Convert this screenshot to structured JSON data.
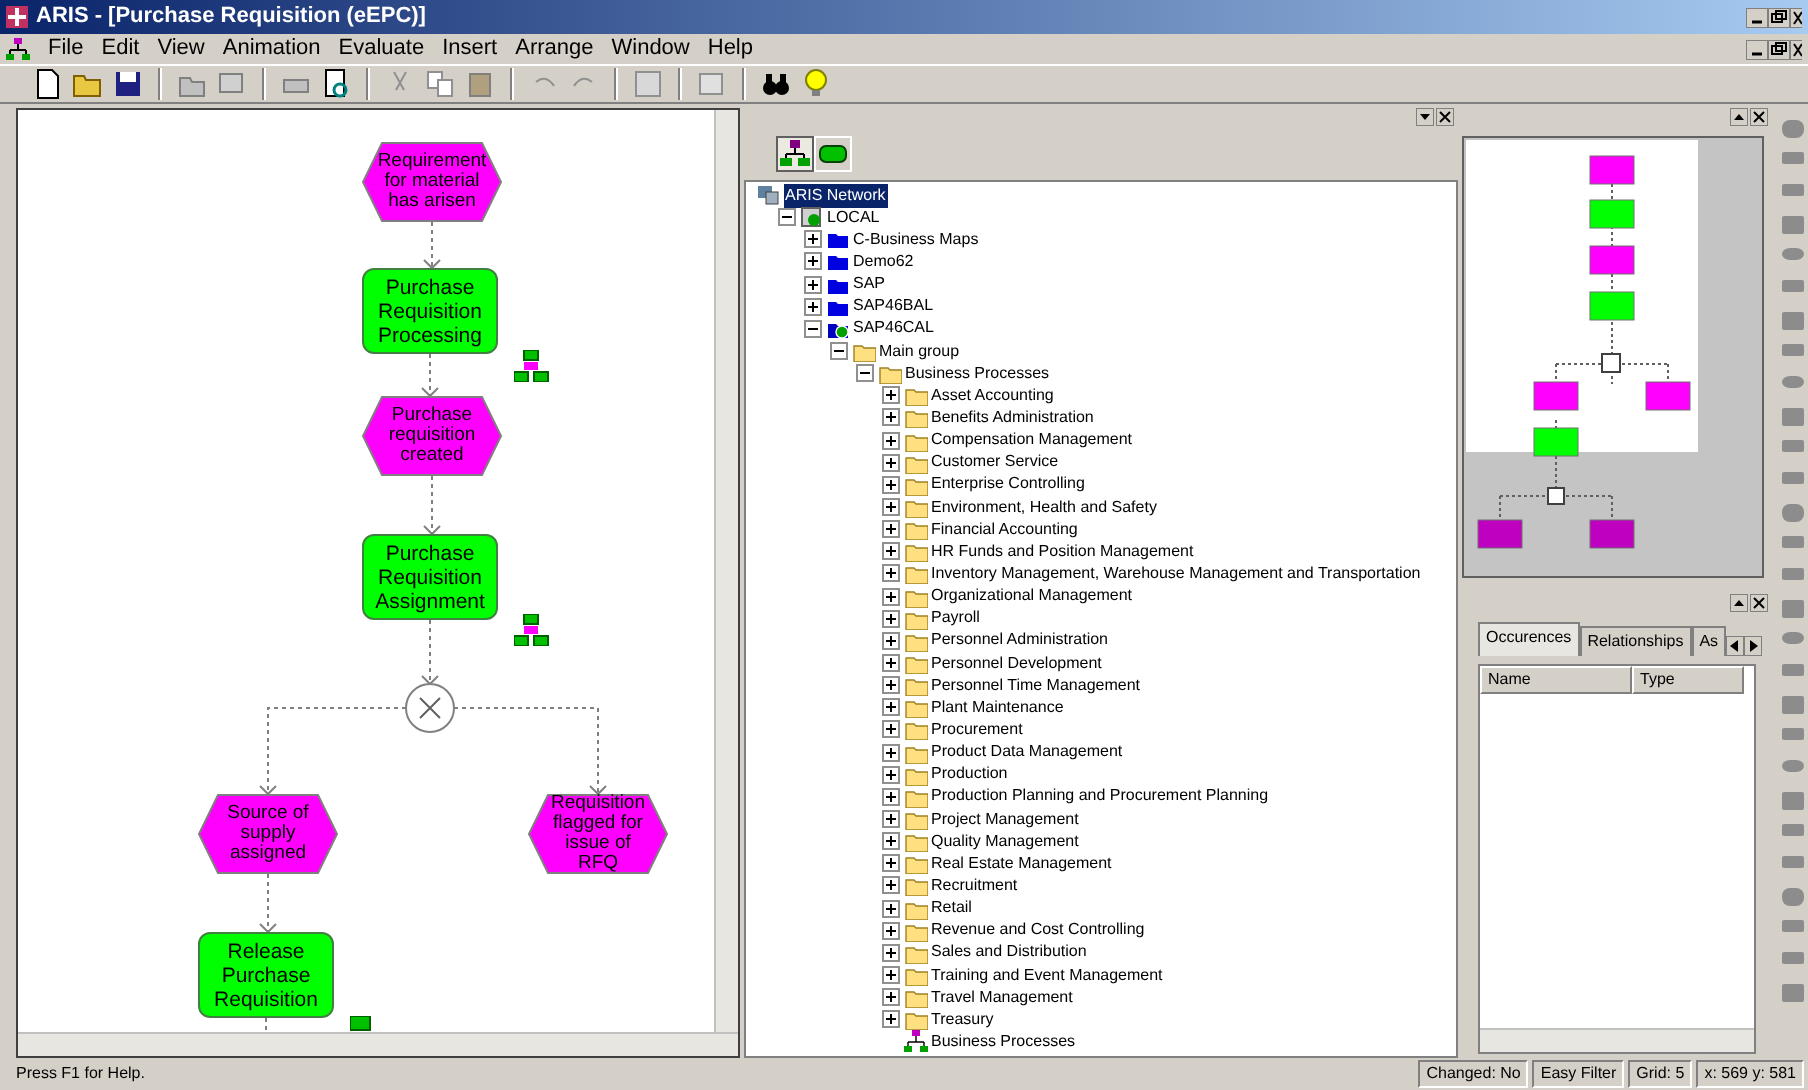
{
  "window": {
    "title": "ARIS - [Purchase Requisition (eEPC)]"
  },
  "menu": [
    "File",
    "Edit",
    "View",
    "Animation",
    "Evaluate",
    "Insert",
    "Arrange",
    "Window",
    "Help"
  ],
  "diagram": {
    "nodes": [
      {
        "kind": "event",
        "text": "Requirement for material has arisen"
      },
      {
        "kind": "function",
        "text": "Purchase Requisition Processing"
      },
      {
        "kind": "event",
        "text": "Purchase requisition created"
      },
      {
        "kind": "function",
        "text": "Purchase Requisition Assignment"
      },
      {
        "kind": "xor"
      },
      {
        "kind": "event",
        "text": "Source of supply assigned"
      },
      {
        "kind": "event",
        "text": "Requisition flagged for issue of RFQ"
      },
      {
        "kind": "function",
        "text": "Release Purchase Requisition"
      }
    ]
  },
  "explorer": {
    "view_buttons": [
      {
        "kind": "navigation",
        "selected": true
      },
      {
        "kind": "library",
        "selected": false
      }
    ],
    "tree": [
      {
        "label": "ARIS Network",
        "kind": "network",
        "selected": true,
        "children": [
          {
            "label": "LOCAL",
            "kind": "server",
            "expanded": true,
            "selected": false,
            "children": [
              {
                "label": "C-Business Maps",
                "kind": "database",
                "expanded": false,
                "selected": false
              },
              {
                "label": "Demo62",
                "kind": "database",
                "expanded": false,
                "selected": false
              },
              {
                "label": "SAP",
                "kind": "database",
                "expanded": false,
                "selected": false
              },
              {
                "label": "SAP46BAL",
                "kind": "database",
                "expanded": false,
                "selected": false
              },
              {
                "label": "SAP46CAL",
                "kind": "database-open",
                "expanded": true,
                "selected": false,
                "children": [
                  {
                    "label": "Main group",
                    "kind": "folder",
                    "expanded": true,
                    "selected": false,
                    "children": [
                      {
                        "label": "Business Processes",
                        "kind": "folder",
                        "expanded": true,
                        "selected": false,
                        "children": [
                          {
                            "label": "Asset Accounting",
                            "kind": "folder",
                            "expanded": false,
                            "selected": false
                          },
                          {
                            "label": "Benefits Administration",
                            "kind": "folder",
                            "expanded": false,
                            "selected": false
                          },
                          {
                            "label": "Compensation Management",
                            "kind": "folder",
                            "expanded": false,
                            "selected": false
                          },
                          {
                            "label": "Customer Service",
                            "kind": "folder",
                            "expanded": false,
                            "selected": false
                          },
                          {
                            "label": "Enterprise Controlling",
                            "kind": "folder",
                            "expanded": false,
                            "selected": false
                          },
                          {
                            "label": "Environment, Health and Safety",
                            "kind": "folder",
                            "expanded": false,
                            "selected": false
                          },
                          {
                            "label": "Financial Accounting",
                            "kind": "folder",
                            "expanded": false,
                            "selected": false
                          },
                          {
                            "label": "HR Funds and Position Management",
                            "kind": "folder",
                            "expanded": false,
                            "selected": false
                          },
                          {
                            "label": "Inventory Management, Warehouse Management and Transportation",
                            "kind": "folder",
                            "expanded": false,
                            "selected": false
                          },
                          {
                            "label": "Organizational Management",
                            "kind": "folder",
                            "expanded": false,
                            "selected": false
                          },
                          {
                            "label": "Payroll",
                            "kind": "folder",
                            "expanded": false,
                            "selected": false
                          },
                          {
                            "label": "Personnel Administration",
                            "kind": "folder",
                            "expanded": false,
                            "selected": false
                          },
                          {
                            "label": "Personnel Development",
                            "kind": "folder",
                            "expanded": false,
                            "selected": false
                          },
                          {
                            "label": "Personnel Time Management",
                            "kind": "folder",
                            "expanded": false,
                            "selected": false
                          },
                          {
                            "label": "Plant Maintenance",
                            "kind": "folder",
                            "expanded": false,
                            "selected": false
                          },
                          {
                            "label": "Procurement",
                            "kind": "folder",
                            "expanded": false,
                            "selected": false
                          },
                          {
                            "label": "Product Data Management",
                            "kind": "folder",
                            "expanded": false,
                            "selected": false
                          },
                          {
                            "label": "Production",
                            "kind": "folder",
                            "expanded": false,
                            "selected": false
                          },
                          {
                            "label": "Production Planning and Procurement Planning",
                            "kind": "folder",
                            "expanded": false,
                            "selected": false
                          },
                          {
                            "label": "Project Management",
                            "kind": "folder",
                            "expanded": false,
                            "selected": false
                          },
                          {
                            "label": "Quality Management",
                            "kind": "folder",
                            "expanded": false,
                            "selected": false
                          },
                          {
                            "label": "Real Estate Management",
                            "kind": "folder",
                            "expanded": false,
                            "selected": false
                          },
                          {
                            "label": "Recruitment",
                            "kind": "folder",
                            "expanded": false,
                            "selected": false
                          },
                          {
                            "label": "Retail",
                            "kind": "folder",
                            "expanded": false,
                            "selected": false
                          },
                          {
                            "label": "Revenue and Cost Controlling",
                            "kind": "folder",
                            "expanded": false,
                            "selected": false
                          },
                          {
                            "label": "Sales and Distribution",
                            "kind": "folder",
                            "expanded": false,
                            "selected": false
                          },
                          {
                            "label": "Training and Event Management",
                            "kind": "folder",
                            "expanded": false,
                            "selected": false
                          },
                          {
                            "label": "Travel Management",
                            "kind": "folder",
                            "expanded": false,
                            "selected": false
                          },
                          {
                            "label": "Treasury",
                            "kind": "folder",
                            "expanded": false,
                            "selected": false
                          },
                          {
                            "label": "Business Processes",
                            "kind": "model",
                            "selected": false
                          }
                        ]
                      }
                    ]
                  }
                ]
              }
            ]
          }
        ]
      }
    ]
  },
  "properties": {
    "tabs": [
      {
        "label": "Occurences",
        "selected": true
      },
      {
        "label": "Relationships",
        "selected": false
      },
      {
        "label": "As",
        "selected": false
      }
    ],
    "columns": [
      "Name",
      "Type"
    ]
  },
  "status_bar": {
    "help": "Press F1 for Help.",
    "panes": [
      "Changed: No",
      "Easy Filter",
      "Grid: 5",
      "x: 569 y: 581"
    ]
  }
}
